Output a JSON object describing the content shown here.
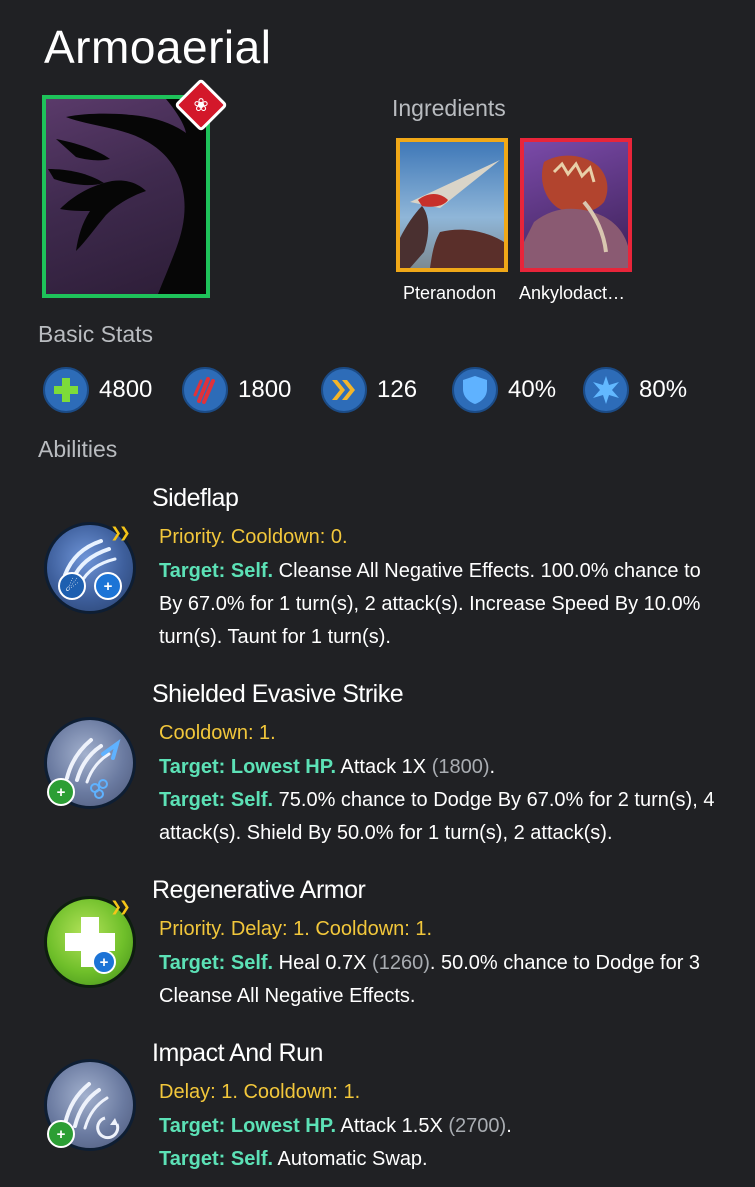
{
  "title": "Armoaerial",
  "ingredients": {
    "label": "Ingredients",
    "items": [
      {
        "name": "Pteranodon",
        "border_color": "#f0a818"
      },
      {
        "name": "Ankylodact…",
        "border_color": "#e8253a"
      }
    ]
  },
  "basic_stats": {
    "label": "Basic Stats",
    "items": [
      {
        "icon": "health-icon",
        "value": "4800"
      },
      {
        "icon": "damage-icon",
        "value": "1800"
      },
      {
        "icon": "speed-icon",
        "value": "126"
      },
      {
        "icon": "armor-icon",
        "value": "40%"
      },
      {
        "icon": "critical-icon",
        "value": "80%"
      }
    ]
  },
  "abilities": {
    "label": "Abilities",
    "items": [
      {
        "name": "Sideflap",
        "info": "Priority. Cooldown: 0.",
        "lines": [
          {
            "target": "Target: Self.",
            "text": " Cleanse All Negative Effects. 100.0% chance to"
          },
          {
            "text": "By 67.0% for 1 turn(s), 2 attack(s). Increase Speed By 10.0%"
          },
          {
            "text": "turn(s). Taunt for 1 turn(s)."
          }
        ]
      },
      {
        "name": "Shielded Evasive Strike",
        "info": "Cooldown: 1.",
        "lines": [
          {
            "target": "Target: Lowest HP.",
            "text": " Attack 1X ",
            "num": "(1800)",
            "tail": "."
          },
          {
            "target": "Target: Self.",
            "text": " 75.0% chance to Dodge By 67.0% for 2 turn(s), 4"
          },
          {
            "text": "attack(s). Shield By 50.0% for 1 turn(s), 2 attack(s)."
          }
        ]
      },
      {
        "name": "Regenerative Armor",
        "info": "Priority. Delay: 1. Cooldown: 1.",
        "lines": [
          {
            "target": "Target: Self.",
            "text": " Heal 0.7X ",
            "num": "(1260)",
            "tail": ". 50.0% chance to Dodge for 3"
          },
          {
            "text": "Cleanse All Negative Effects."
          }
        ]
      },
      {
        "name": "Impact And Run",
        "info": "Delay: 1. Cooldown: 1.",
        "lines": [
          {
            "target": "Target: Lowest HP.",
            "text": " Attack 1.5X ",
            "num": "(2700)",
            "tail": "."
          },
          {
            "target": "Target: Self.",
            "text": " Automatic Swap."
          }
        ]
      }
    ]
  },
  "colors": {
    "background": "#202124",
    "target_text": "#5ce1b6",
    "info_text": "#f2c73b",
    "rarity_green": "#1ec25a"
  }
}
